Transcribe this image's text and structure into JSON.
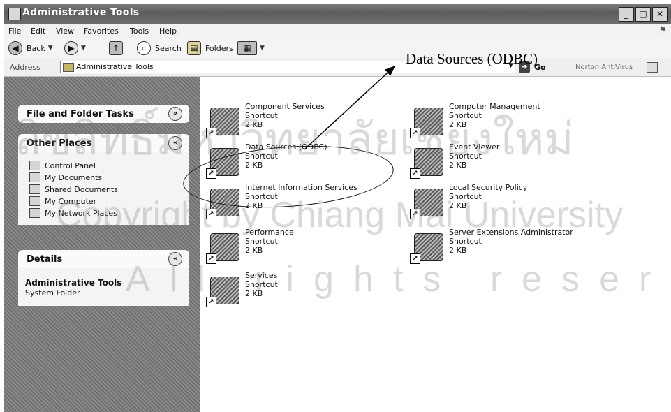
{
  "window": {
    "title": "Administrative Tools",
    "buttons": {
      "minimize": "_",
      "maximize": "□",
      "close": "✕"
    }
  },
  "menu": [
    "File",
    "Edit",
    "View",
    "Favorites",
    "Tools",
    "Help"
  ],
  "toolbar": {
    "back": "Back",
    "search": "Search",
    "folders": "Folders"
  },
  "address": {
    "label": "Address",
    "value": "Administrative Tools",
    "go": "Go",
    "norton": "Norton AntiVirus"
  },
  "annotation": {
    "label": "Data Sources (ODBC)"
  },
  "left_pane": {
    "file_tasks": {
      "title": "File and Folder Tasks"
    },
    "other_places": {
      "title": "Other Places",
      "items": [
        "Control Panel",
        "My Documents",
        "Shared Documents",
        "My Computer",
        "My Network Places"
      ]
    },
    "details": {
      "title": "Details",
      "name": "Administrative Tools",
      "type": "System Folder"
    }
  },
  "items": [
    {
      "name": "Component Services",
      "type": "Shortcut",
      "size": "2 KB",
      "icon": "component-services-icon"
    },
    {
      "name": "Computer Management",
      "type": "Shortcut",
      "size": "2 KB",
      "icon": "computer-management-icon"
    },
    {
      "name": "Data Sources (ODBC)",
      "type": "Shortcut",
      "size": "2 KB",
      "icon": "data-sources-icon"
    },
    {
      "name": "Event Viewer",
      "type": "Shortcut",
      "size": "2 KB",
      "icon": "event-viewer-icon"
    },
    {
      "name": "Internet Information Services",
      "type": "Shortcut",
      "size": "2 KB",
      "icon": "iis-icon"
    },
    {
      "name": "Local Security Policy",
      "type": "Shortcut",
      "size": "2 KB",
      "icon": "local-security-policy-icon"
    },
    {
      "name": "Performance",
      "type": "Shortcut",
      "size": "2 KB",
      "icon": "performance-icon"
    },
    {
      "name": "Server Extensions Administrator",
      "type": "Shortcut",
      "size": "2 KB",
      "icon": "server-extensions-icon"
    },
    {
      "name": "Services",
      "type": "Shortcut",
      "size": "2 KB",
      "icon": "services-icon"
    }
  ],
  "watermark": {
    "line1": "ลิขสิทธิ์มหาวิทยาลัยเชียงใหม่",
    "line2": "Copyright by Chiang Mai University",
    "line3": "All rights reserved"
  }
}
